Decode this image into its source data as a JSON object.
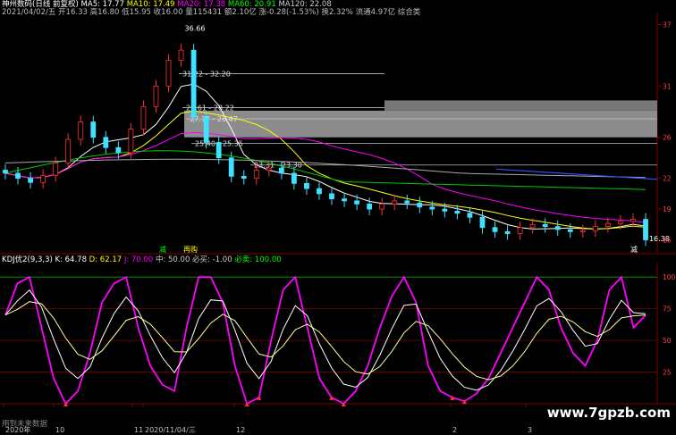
{
  "header": {
    "stock_name": "神州数码(日线 前复权)",
    "ma_labels": [
      {
        "text": "MA5: 17.77",
        "color": "#ffffff"
      },
      {
        "text": "MA10: 17.49",
        "color": "#ffff00"
      },
      {
        "text": "MA20: 17.38",
        "color": "#ff00ff"
      },
      {
        "text": "MA60: 20.91",
        "color": "#00ff00"
      },
      {
        "text": "MA120: 22.08",
        "color": "#cccccc"
      }
    ],
    "quote_line": "2021/04/02/五 开16.33 高16.80 低15.95 收16.00 量115431 额2.10亿 涨-0.28(-1.53%) 换2.32% 流通4.97亿 综合类"
  },
  "price_panel": {
    "price_labels": [
      {
        "text": "36.66",
        "color": "#ffffff"
      },
      {
        "text": "16.38",
        "color": "#ffffff"
      }
    ],
    "chip_levels": [
      {
        "text": "31.22 - 32.20"
      },
      {
        "text": "29.61 - 28.22"
      },
      {
        "text": "27.77 - 26.47"
      },
      {
        "text": "25.40 - 25.35"
      },
      {
        "text": "23.31 - 23.30"
      }
    ],
    "right_axis": [
      "37",
      "31",
      "26",
      "22",
      "19",
      "16"
    ],
    "signal_labels": [
      {
        "text": "减",
        "color": "#00ff00"
      },
      {
        "text": "再购",
        "color": "#ffff00"
      },
      {
        "text": "减",
        "color": "#ffffff"
      }
    ]
  },
  "indicator_panel": {
    "title": "KDJ优2(9,3,3)",
    "values": [
      {
        "text": "K: 64.78",
        "color": "#ffffff"
      },
      {
        "text": "D: 62.17",
        "color": "#ffff00"
      },
      {
        "text": "J: 70.00",
        "color": "#ff00ff"
      },
      {
        "text": "中: 50.00",
        "color": "#cccccc"
      },
      {
        "text": "必买: -1.00",
        "color": "#cccccc"
      },
      {
        "text": "必卖: 100.00",
        "color": "#00ff00"
      }
    ],
    "right_axis": [
      "100",
      "75",
      "50",
      "25"
    ]
  },
  "footer": {
    "note": "用到未来数据",
    "dates": [
      {
        "text": "2020年"
      },
      {
        "text": "10"
      },
      {
        "text": "11"
      },
      {
        "text": "2020/11/04/三"
      },
      {
        "text": "12"
      },
      {
        "text": "2"
      },
      {
        "text": "3"
      }
    ]
  },
  "watermark": "www.7gpzb.com",
  "chart_data": [
    {
      "type": "candlestick",
      "title": "神州数码(日线 前复权)",
      "x_range": [
        "2020-09",
        "2021-04-02"
      ],
      "ylim": [
        15,
        38
      ],
      "y_ticks": [
        37,
        31,
        26,
        22,
        19,
        16
      ],
      "series": [
        {
          "name": "MA5",
          "color": "#ffffff",
          "last": 17.77
        },
        {
          "name": "MA10",
          "color": "#ffff00",
          "last": 17.49
        },
        {
          "name": "MA20",
          "color": "#ff00ff",
          "last": 17.38
        },
        {
          "name": "MA60",
          "color": "#00ff00",
          "last": 20.91
        },
        {
          "name": "MA120",
          "color": "#cccccc",
          "last": 22.08
        }
      ],
      "close_path": [
        22.5,
        22.0,
        21.6,
        22.3,
        23.5,
        25.8,
        27.5,
        26.0,
        25.0,
        24.5,
        26.8,
        29.0,
        31.0,
        33.5,
        34.5,
        28.0,
        25.5,
        24.0,
        22.2,
        22.0,
        22.8,
        23.0,
        22.5,
        21.5,
        21.0,
        20.5,
        20.0,
        19.8,
        19.5,
        19.0,
        19.5,
        19.8,
        19.6,
        19.2,
        19.0,
        18.8,
        18.6,
        18.2,
        17.2,
        16.8,
        16.6,
        17.2,
        17.5,
        17.3,
        17.0,
        16.8,
        16.9,
        17.3,
        17.6,
        17.8,
        18.0,
        16.0
      ],
      "high_mark": 36.66,
      "low_mark": 16.38,
      "last_bar": {
        "open": 16.33,
        "high": 16.8,
        "low": 15.95,
        "close": 16.0
      }
    },
    {
      "type": "line",
      "title": "KDJ优2(9,3,3)",
      "ylim": [
        0,
        110
      ],
      "y_ticks": [
        100,
        75,
        50,
        25
      ],
      "series": [
        {
          "name": "K",
          "color": "#ffffff",
          "last": 64.78
        },
        {
          "name": "D",
          "color": "#ffff00",
          "last": 62.17
        },
        {
          "name": "J",
          "color": "#ff00ff",
          "last": 70.0
        }
      ],
      "reference_lines": [
        {
          "name": "中",
          "value": 50.0
        },
        {
          "name": "必买",
          "value": -1.0
        },
        {
          "name": "必卖",
          "value": 100.0
        }
      ],
      "j_path": [
        70,
        95,
        100,
        60,
        20,
        0,
        10,
        40,
        80,
        95,
        100,
        60,
        30,
        15,
        10,
        60,
        100,
        100,
        80,
        30,
        0,
        5,
        50,
        90,
        100,
        60,
        20,
        5,
        0,
        10,
        30,
        60,
        85,
        100,
        80,
        30,
        10,
        5,
        2,
        8,
        20,
        40,
        60,
        80,
        100,
        90,
        60,
        40,
        30,
        50,
        90,
        100,
        60,
        70
      ]
    }
  ]
}
